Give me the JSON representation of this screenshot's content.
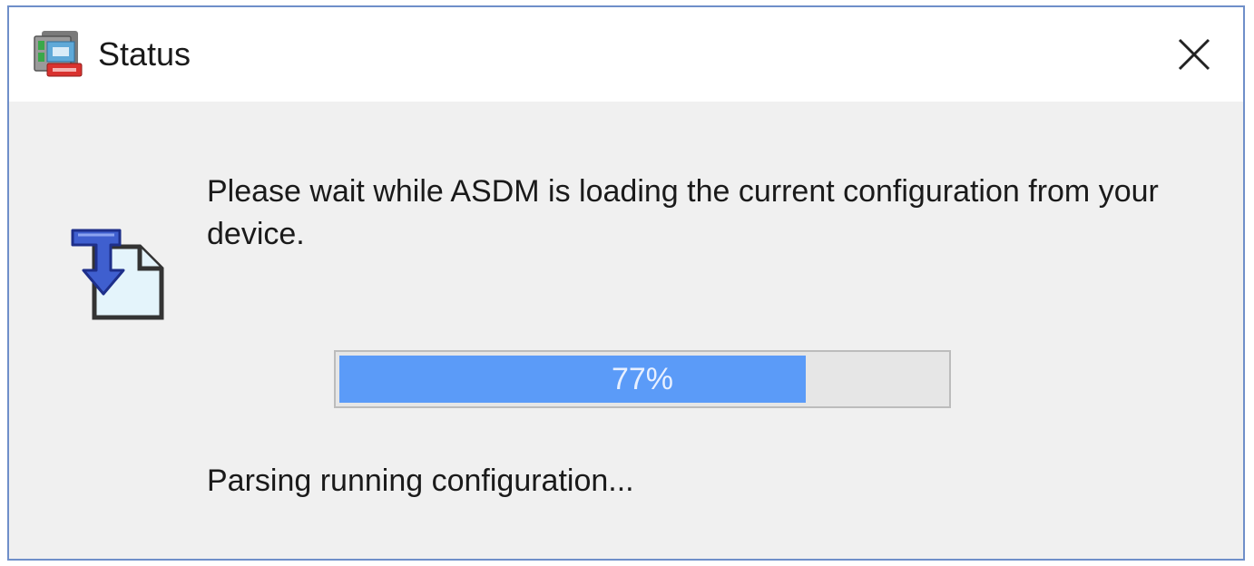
{
  "window": {
    "title": "Status",
    "app_icon": "asdm-app-icon",
    "close_icon": "close-icon"
  },
  "content": {
    "icon": "download-config-icon",
    "message": "Please wait while ASDM is loading the current configuration from your device.",
    "progress": {
      "value": 0.77,
      "label": "77%"
    },
    "status": "Parsing running configuration..."
  },
  "colors": {
    "window_border": "#6f8fc9",
    "progress_fill": "#5b9bf8",
    "progress_track": "#e6e6e6",
    "background": "#f0f0f0"
  }
}
